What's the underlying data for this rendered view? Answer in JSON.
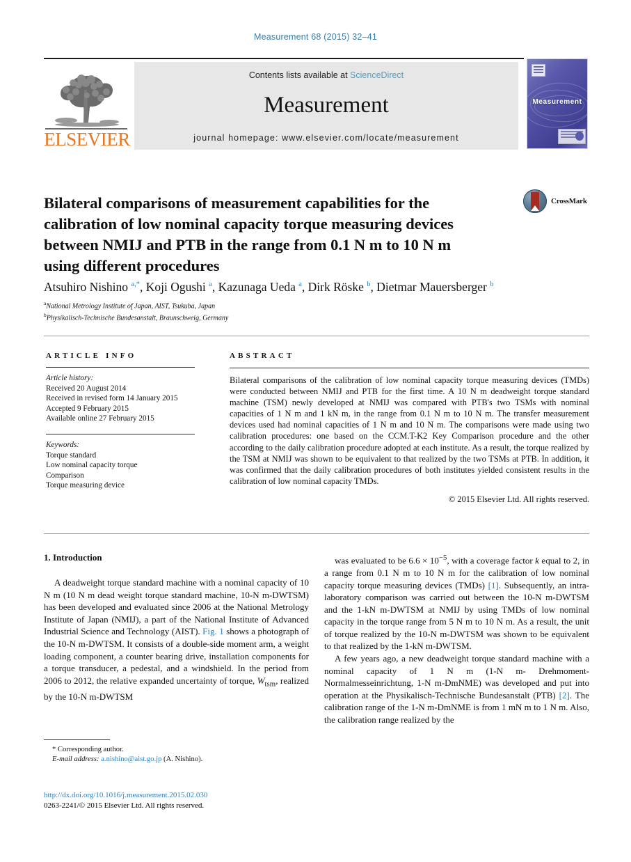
{
  "running_head": "Measurement 68 (2015) 32–41",
  "banner": {
    "contents_prefix": "Contents lists available at ",
    "sciencedirect": "ScienceDirect",
    "journal_name": "Measurement",
    "homepage": "journal homepage: www.elsevier.com/locate/measurement",
    "publisher_logo_text": "ELSEVIER",
    "cover_title": "Measurement"
  },
  "article": {
    "title": "Bilateral comparisons of measurement capabilities for the calibration of low nominal capacity torque measuring devices between NMIJ and PTB in the range from 0.1 N m to 10 N m using different procedures",
    "crossmark_label": "CrossMark",
    "authors_html": "Atsuhiro Nishino <sup>a,*</sup>, Koji Ogushi <sup>a</sup>, Kazunaga Ueda <sup>a</sup>, Dirk Röske <sup>b</sup>, Dietmar Mauersberger <sup>b</sup>",
    "affiliations": [
      {
        "marker": "a",
        "text": "National Metrology Institute of Japan, AIST, Tsukuba, Japan"
      },
      {
        "marker": "b",
        "text": "Physikalisch-Technische Bundesanstalt, Braunschweig, Germany"
      }
    ]
  },
  "article_info": {
    "heading": "ARTICLE INFO",
    "history_label": "Article history:",
    "history": [
      "Received 20 August 2014",
      "Received in revised form 14 January 2015",
      "Accepted 9 February 2015",
      "Available online 27 February 2015"
    ],
    "keywords_label": "Keywords:",
    "keywords": [
      "Torque standard",
      "Low nominal capacity torque",
      "Comparison",
      "Torque measuring device"
    ]
  },
  "abstract": {
    "heading": "ABSTRACT",
    "text": "Bilateral comparisons of the calibration of low nominal capacity torque measuring devices (TMDs) were conducted between NMIJ and PTB for the first time. A 10 N m deadweight torque standard machine (TSM) newly developed at NMIJ was compared with PTB's two TSMs with nominal capacities of 1 N m and 1 kN m, in the range from 0.1 N m to 10 N m. The transfer measurement devices used had nominal capacities of 1 N m and 10 N m. The comparisons were made using two calibration procedures: one based on the CCM.T-K2 Key Comparison procedure and the other according to the daily calibration procedure adopted at each institute. As a result, the torque realized by the TSM at NMIJ was shown to be equivalent to that realized by the two TSMs at PTB. In addition, it was confirmed that the daily calibration procedures of both institutes yielded consistent results in the calibration of low nominal capacity TMDs.",
    "copyright": "© 2015 Elsevier Ltd. All rights reserved."
  },
  "introduction": {
    "heading": "1. Introduction",
    "left_paragraph_html": "A deadweight torque standard machine with a nominal capacity of 10 N m (10 N m dead weight torque standard machine, 10-N m-DWTSM) has been developed and evaluated since 2006 at the National Metrology Institute of Japan (NMIJ), a part of the National Institute of Advanced Industrial Science and Technology (AIST). <span class=\"lnk\">Fig. 1</span> shows a photograph of the 10-N m-DWTSM. It consists of a double-side moment arm, a weight loading component, a counter bearing drive, installation components for a torque transducer, a pedestal, and a windshield. In the period from 2006 to 2012, the relative expanded uncertainty of torque, <i>W</i><sub>tsm</sub>, realized by the 10-N m-DWTSM",
    "right_paragraph_1_html": "was evaluated to be 6.6 &times; 10<sup>&minus;5</sup>, with a coverage factor <i>k</i> equal to 2, in a range from 0.1 N m to 10 N m for the calibration of low nominal capacity torque measuring devices (TMDs) <span class=\"lnk\">[1]</span>. Subsequently, an intra-laboratory comparison was carried out between the 10-N m-DWTSM and the 1-kN m-DWTSM at NMIJ by using TMDs of low nominal capacity in the torque range from 5 N m to 10 N m. As a result, the unit of torque realized by the 10-N m-DWTSM was shown to be equivalent to that realized by the 1-kN m-DWTSM.",
    "right_paragraph_2_html": "A few years ago, a new deadweight torque standard machine with a nominal capacity of 1 N m (1-N m- Drehmoment-Normalmesseinrichtung, 1-N m-DmNME) was developed and put into operation at the Physikalisch-Technische Bundesanstalt (PTB) <span class=\"lnk\">[2]</span>. The calibration range of the 1-N m-DmNME is from 1 mN m to 1 N m. Also, the calibration range realized by the"
  },
  "footnote": {
    "corresponding": "* Corresponding author.",
    "email_label": "E-mail address:",
    "email": "a.nishino@aist.go.jp",
    "email_suffix": "(A. Nishino)."
  },
  "footer": {
    "doi": "http://dx.doi.org/10.1016/j.measurement.2015.02.030",
    "issn_line": "0263-2241/© 2015 Elsevier Ltd. All rights reserved."
  },
  "colors": {
    "link": "#2d7fb8",
    "sciencedirect": "#4f9ec4",
    "elsevier_orange": "#e87722",
    "cover_purple": "#4b4a9e",
    "crossmark_red": "#a62b21"
  }
}
